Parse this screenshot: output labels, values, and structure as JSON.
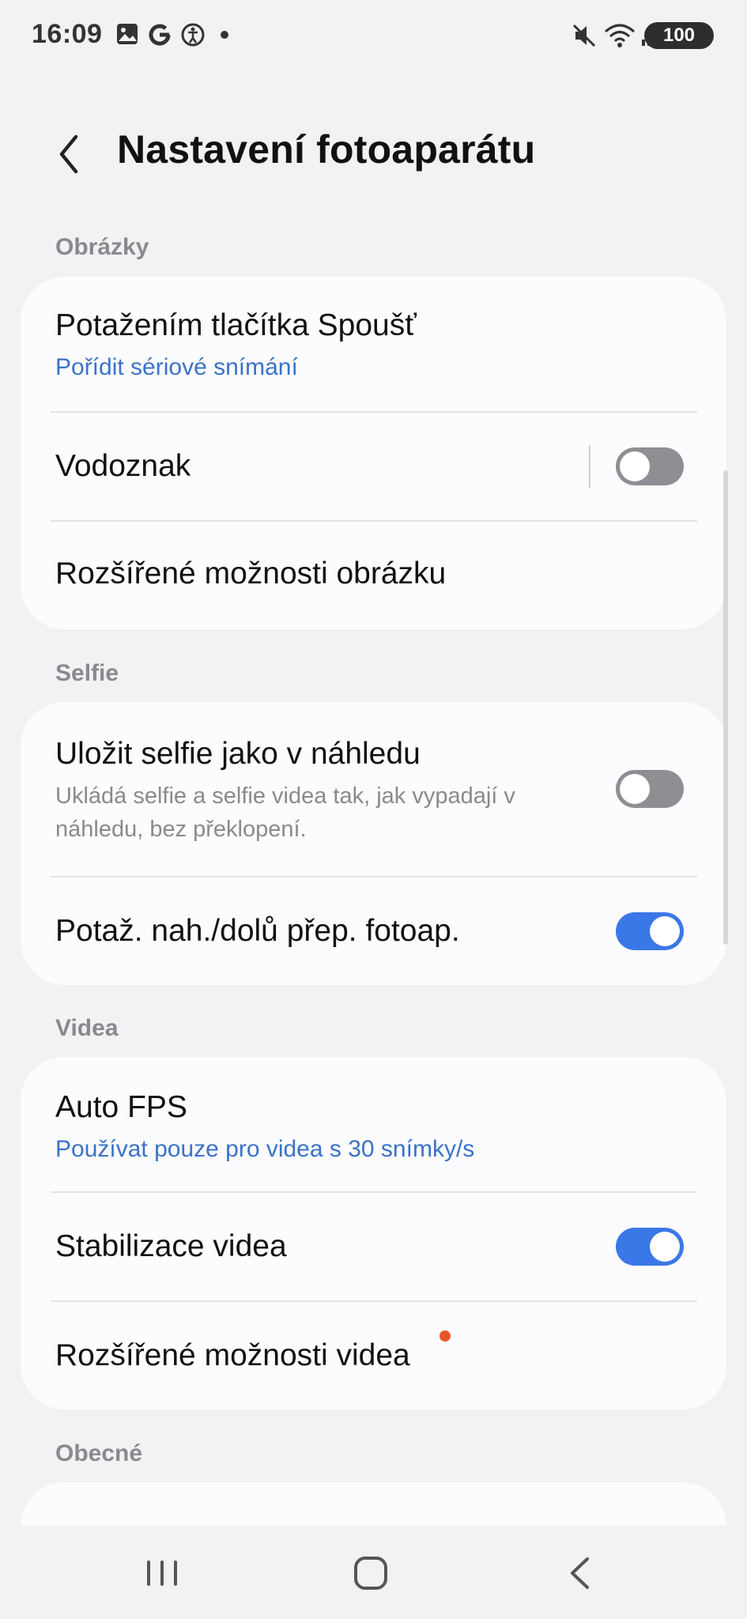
{
  "status_bar": {
    "time": "16:09",
    "left_icons": [
      "gallery-icon",
      "google-icon",
      "accessibility-icon",
      "notification-dot-icon"
    ],
    "right_icons": [
      "mute-icon",
      "wifi-icon",
      "signal-icon"
    ],
    "battery": "100"
  },
  "header": {
    "title": "Nastavení fotoaparátu"
  },
  "sections": {
    "images": {
      "label": "Obrázky",
      "items": [
        {
          "title": "Potažením tlačítka Spoušť",
          "subtitle": "Pořídit sériové snímání"
        },
        {
          "title": "Vodoznak",
          "toggle": false
        },
        {
          "title": "Rozšířené možnosti obrázku"
        }
      ]
    },
    "selfie": {
      "label": "Selfie",
      "items": [
        {
          "title": "Uložit selfie jako v náhledu",
          "description": "Ukládá selfie a selfie videa tak, jak vypadají v náhledu, bez překlopení.",
          "toggle": false
        },
        {
          "title": "Potaž. nah./dolů přep. fotoap.",
          "toggle": true
        }
      ]
    },
    "videos": {
      "label": "Videa",
      "items": [
        {
          "title": "Auto FPS",
          "subtitle": "Používat pouze pro videa s 30 snímky/s"
        },
        {
          "title": "Stabilizace videa",
          "toggle": true
        },
        {
          "title": "Rozšířené možnosti videa",
          "badge": "new-dot"
        }
      ]
    },
    "general": {
      "label": "Obecné"
    }
  },
  "colors": {
    "accent": "#3b78e7",
    "subtitle_blue": "#3a72c8",
    "badge_orange": "#e8572a",
    "background": "#f2f2f4"
  },
  "nav_bar": {
    "buttons": [
      "recents-icon",
      "home-icon",
      "back-icon"
    ]
  }
}
